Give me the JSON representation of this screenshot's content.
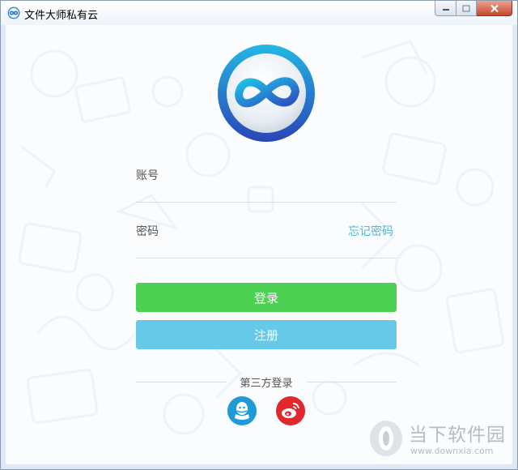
{
  "window": {
    "title": "文件大师私有云"
  },
  "form": {
    "account_label": "账号",
    "password_label": "密码",
    "forgot_password": "忘记密码",
    "login_button": "登录",
    "register_button": "注册",
    "third_party_label": "第三方登录"
  },
  "social": [
    {
      "name": "qq-icon",
      "color": "#1e9ad6"
    },
    {
      "name": "weibo-icon",
      "color": "#e0282e"
    }
  ],
  "watermark": {
    "brand": "当下软件园",
    "url": "www.downxia.com"
  },
  "colors": {
    "login": "#4cd152",
    "register": "#66c9e7",
    "link": "#4cb8de"
  }
}
